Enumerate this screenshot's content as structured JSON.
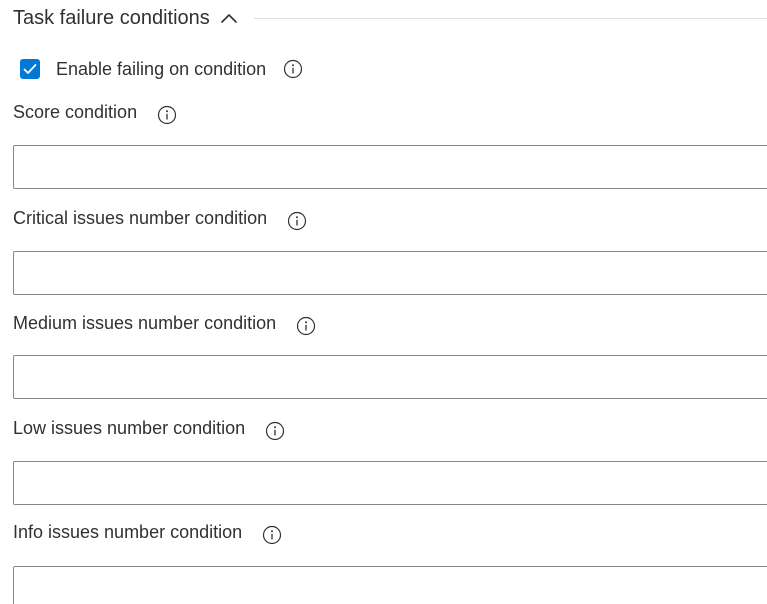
{
  "section": {
    "title": "Task failure conditions",
    "expanded": true,
    "chevron_icon": "chevron-up-icon"
  },
  "enable_failing": {
    "label": "Enable failing on condition",
    "checked": true,
    "icon": "info-icon"
  },
  "fields": [
    {
      "label": "Score condition",
      "value": "",
      "icon": "info-icon"
    },
    {
      "label": "Critical issues number condition",
      "value": "",
      "icon": "info-icon"
    },
    {
      "label": "Medium issues number condition",
      "value": "",
      "icon": "info-icon"
    },
    {
      "label": "Low issues number condition",
      "value": "",
      "icon": "info-icon"
    },
    {
      "label": "Info issues number condition",
      "value": "",
      "icon": "info-icon"
    }
  ],
  "colors": {
    "accent": "#0078d4",
    "text": "#323130",
    "input_border": "#8a8886",
    "divider": "#e1dfdd"
  }
}
